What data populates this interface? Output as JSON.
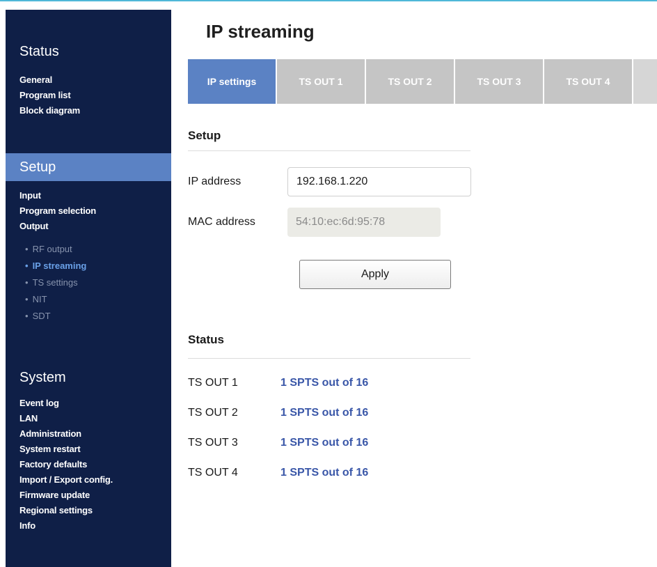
{
  "sidebar": {
    "status": {
      "heading": "Status",
      "items": [
        "General",
        "Program list",
        "Block diagram"
      ]
    },
    "setup": {
      "heading": "Setup",
      "items": [
        "Input",
        "Program selection",
        "Output"
      ],
      "output_subitems": [
        "RF output",
        "IP streaming",
        "TS settings",
        "NIT",
        "SDT"
      ],
      "current_subitem": "IP streaming"
    },
    "system": {
      "heading": "System",
      "items": [
        "Event log",
        "LAN",
        "Administration",
        "System restart",
        "Factory defaults",
        "Import / Export config.",
        "Firmware update",
        "Regional settings",
        "Info"
      ]
    }
  },
  "page": {
    "title": "IP streaming",
    "tabs": [
      "IP settings",
      "TS OUT 1",
      "TS OUT 2",
      "TS OUT 3",
      "TS OUT 4"
    ],
    "active_tab": "IP settings"
  },
  "setup_section": {
    "title": "Setup",
    "ip_label": "IP address",
    "ip_value": "192.168.1.220",
    "mac_label": "MAC address",
    "mac_value": "54:10:ec:6d:95:78",
    "apply_label": "Apply"
  },
  "status_section": {
    "title": "Status",
    "rows": [
      {
        "name": "TS OUT 1",
        "value": "1 SPTS out of 16"
      },
      {
        "name": "TS OUT 2",
        "value": "1 SPTS out of 16"
      },
      {
        "name": "TS OUT 3",
        "value": "1 SPTS out of 16"
      },
      {
        "name": "TS OUT 4",
        "value": "1 SPTS out of 16"
      }
    ]
  },
  "colors": {
    "sidebar_bg": "#0f1f47",
    "accent": "#5b82c4",
    "status_value": "#3a57a8",
    "inactive_tab": "#c5c5c5"
  }
}
